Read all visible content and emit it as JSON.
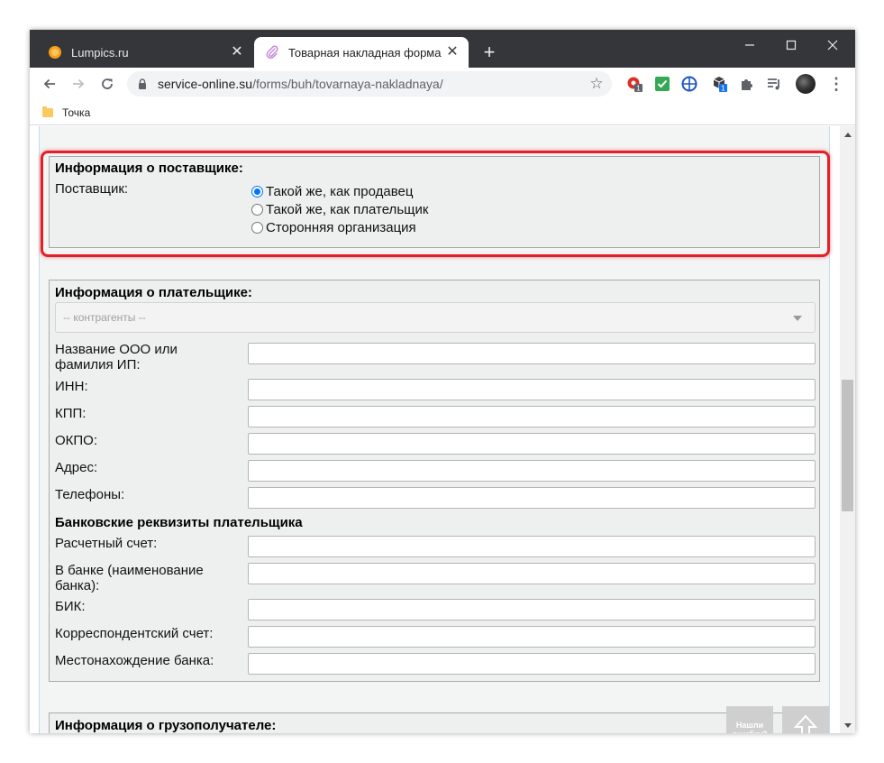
{
  "browser": {
    "tabs": [
      {
        "title": "Lumpics.ru",
        "favicon": "orange-circle-icon",
        "active": false
      },
      {
        "title": "Товарная накладная форма №",
        "favicon": "paperclip-icon",
        "active": true
      }
    ],
    "url_domain": "service-online.su",
    "url_path": "/forms/buh/tovarnaya-nakladnaya/",
    "bookmark": "Точка",
    "extension_badges": [
      "1",
      "1"
    ]
  },
  "supplier": {
    "title": "Информация о поставщике:",
    "label": "Поставщик:",
    "options": [
      {
        "label": "Такой же, как продавец",
        "checked": true
      },
      {
        "label": "Такой же, как плательщик",
        "checked": false
      },
      {
        "label": "Сторонняя организация",
        "checked": false
      }
    ]
  },
  "payer": {
    "title": "Информация о плательщике:",
    "contractors_placeholder": "-- контрагенты --",
    "fields": [
      {
        "label": "Название ООО или фамилия ИП:",
        "value": ""
      },
      {
        "label": "ИНН:",
        "value": ""
      },
      {
        "label": "КПП:",
        "value": ""
      },
      {
        "label": "ОКПО:",
        "value": ""
      },
      {
        "label": "Адрес:",
        "value": ""
      },
      {
        "label": "Телефоны:",
        "value": ""
      }
    ],
    "bank_title": "Банковские реквизиты плательщика",
    "bank_fields": [
      {
        "label": "Расчетный счет:",
        "value": ""
      },
      {
        "label": "В банке (наименование банка):",
        "value": ""
      },
      {
        "label": "БИК:",
        "value": ""
      },
      {
        "label": "Корреспондентский счет:",
        "value": ""
      },
      {
        "label": "Местонахождение банка:",
        "value": ""
      }
    ]
  },
  "consignee": {
    "title": "Информация о грузополучателе:"
  },
  "floating": {
    "error_button": "Нашли ошибку?"
  },
  "colors": {
    "highlight": "#e3202a",
    "radio_accent": "#0075ff"
  }
}
